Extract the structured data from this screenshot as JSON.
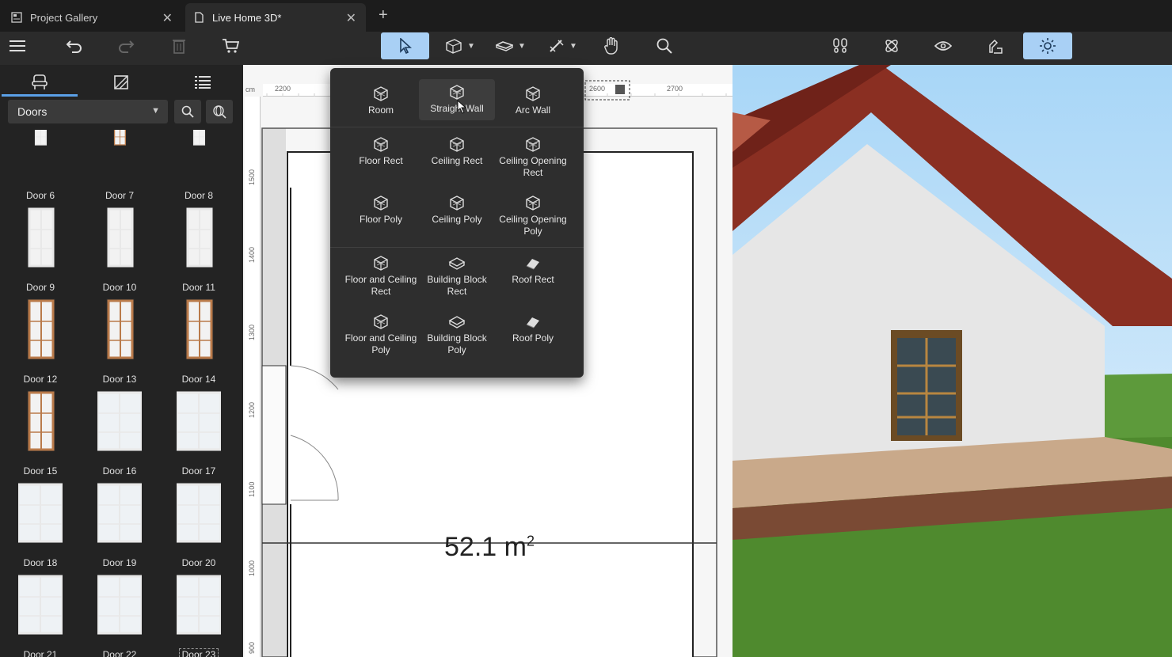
{
  "tabs": {
    "gallery": {
      "label": "Project Gallery",
      "close": "✕"
    },
    "live": {
      "label": "Live Home 3D*",
      "close": "✕"
    },
    "add": "+"
  },
  "toolbar": {
    "items": [
      "menu-icon",
      "undo-icon",
      "redo-icon",
      "trash-icon",
      "cart-icon",
      "select-icon",
      "wall-tool-icon",
      "surface-tool-icon",
      "dimension-tool-icon",
      "pan-icon",
      "search-icon",
      "walk-icon",
      "orbit-icon",
      "eye-icon",
      "sun-icon"
    ],
    "active_color": "#a9d0f5"
  },
  "library": {
    "category": "Doors",
    "items": [
      "Door 6",
      "Door 7",
      "Door 8",
      "Door 9",
      "Door 10",
      "Door 11",
      "Door 12",
      "Door 13",
      "Door 14",
      "Door 15",
      "Door 16",
      "Door 17",
      "Door 18",
      "Door 19",
      "Door 20",
      "Door 21",
      "Door 22",
      "Door 23"
    ],
    "selected": "Door 23"
  },
  "plan": {
    "ruler_unit": "cm",
    "ruler_top": [
      "2200",
      "2600",
      "2700"
    ],
    "ruler_left": [
      "1500",
      "1400",
      "1300",
      "1200",
      "1100",
      "1000",
      "900"
    ],
    "area_value": "52.1 m",
    "area_exp": "2"
  },
  "build_menu": {
    "items": [
      {
        "label": "Room"
      },
      {
        "label": "Straight Wall"
      },
      {
        "label": "Arc Wall"
      },
      {
        "label": "Floor Rect"
      },
      {
        "label": "Ceiling Rect"
      },
      {
        "label": "Ceiling Opening Rect"
      },
      {
        "label": "Floor Poly"
      },
      {
        "label": "Ceiling Poly"
      },
      {
        "label": "Ceiling Opening Poly"
      },
      {
        "label": "Floor and Ceiling Rect"
      },
      {
        "label": "Building Block Rect"
      },
      {
        "label": "Roof Rect"
      },
      {
        "label": "Floor and Ceiling Poly"
      },
      {
        "label": "Building Block Poly"
      },
      {
        "label": "Roof Poly"
      }
    ],
    "hovered": "Straight Wall"
  },
  "colors": {
    "wall": "#e6e6e6",
    "roof": "#8a2f22",
    "deck": "#c9a98a",
    "grass": "#4f8a2e",
    "sky": "#a8d6f7"
  }
}
